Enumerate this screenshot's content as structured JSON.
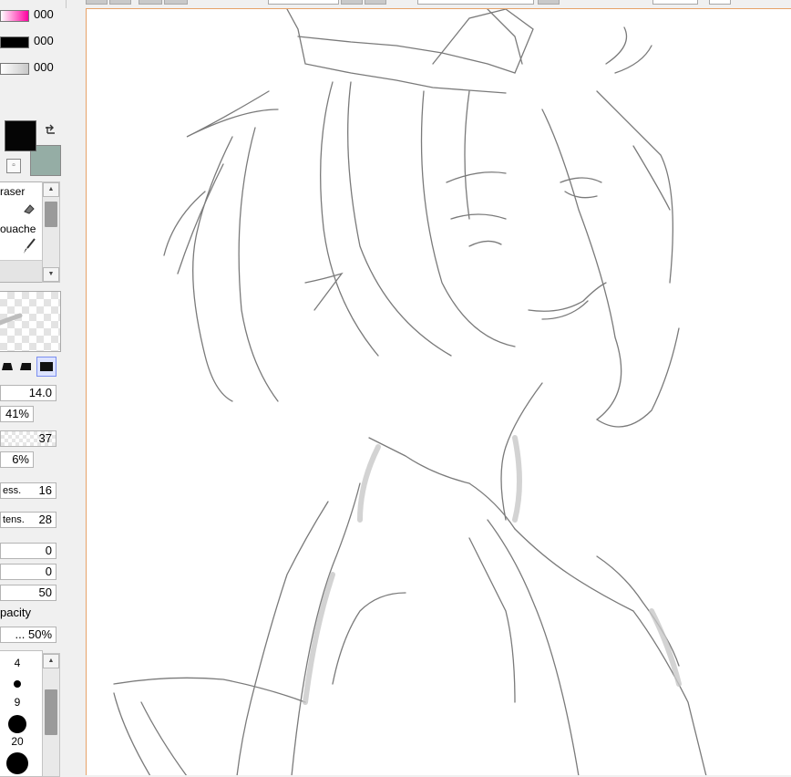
{
  "color_sliders": [
    {
      "value": "000",
      "gradient": "linear-gradient(90deg,#ffffff,#ff00a0)"
    },
    {
      "value": "000",
      "gradient": "linear-gradient(90deg,#000000,#000000)"
    },
    {
      "value": "000",
      "gradient": "linear-gradient(90deg,#ffffff,#c8c8c8)"
    }
  ],
  "colors": {
    "foreground": "#050505",
    "background": "#95ada5",
    "canvas_border": "#e6a268"
  },
  "tools": [
    {
      "label": "raser",
      "icon": "eraser-icon"
    },
    {
      "label": "ouache",
      "icon": "brush-icon"
    }
  ],
  "brush": {
    "size": "14.0",
    "min_size": "41%",
    "density": "37",
    "min_density": "6%",
    "blending_label": "ess.",
    "blending_value": "16",
    "dilution_label": "tens.",
    "dilution_value": "28",
    "field_a": "0",
    "field_b": "0",
    "field_c": "50",
    "opacity_label": "pacity",
    "opacity_value": "... 50%"
  },
  "brush_sizes": [
    "4",
    "9",
    "20"
  ],
  "icons": {
    "swap": "swap-colors-icon",
    "transparent": "transparent-color-icon",
    "scroll_up": "scroll-up-icon",
    "scroll_down": "scroll-down-icon"
  }
}
